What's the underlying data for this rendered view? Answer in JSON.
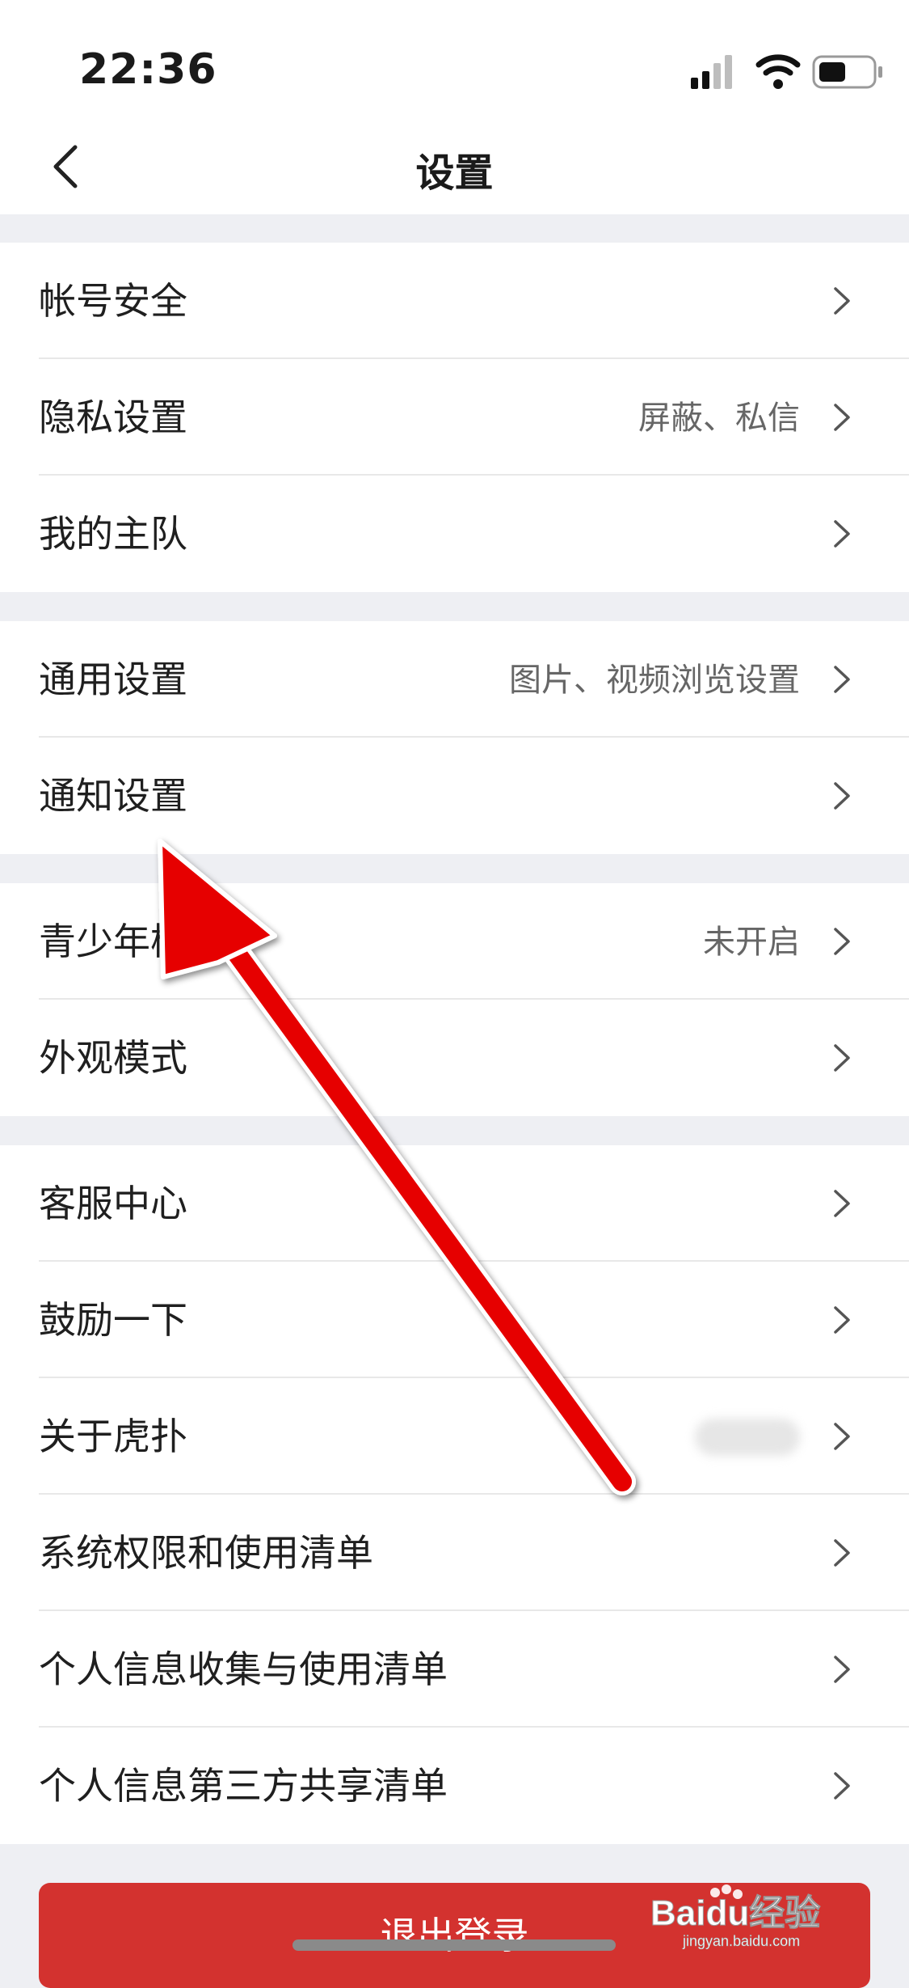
{
  "status_bar": {
    "time": "22:36"
  },
  "header": {
    "title": "设置"
  },
  "groups": [
    {
      "items": [
        {
          "label": "帐号安全",
          "value": ""
        },
        {
          "label": "隐私设置",
          "value": "屏蔽、私信"
        },
        {
          "label": "我的主队",
          "value": ""
        }
      ]
    },
    {
      "items": [
        {
          "label": "通用设置",
          "value": "图片、视频浏览设置"
        },
        {
          "label": "通知设置",
          "value": ""
        }
      ]
    },
    {
      "items": [
        {
          "label": "青少年模",
          "value": "未开启"
        },
        {
          "label": "外观模式",
          "value": ""
        }
      ]
    },
    {
      "items": [
        {
          "label": "客服中心",
          "value": ""
        },
        {
          "label": "鼓励一下",
          "value": ""
        },
        {
          "label": "关于虎扑",
          "value": ""
        },
        {
          "label": "系统权限和使用清单",
          "value": ""
        },
        {
          "label": "个人信息收集与使用清单",
          "value": ""
        },
        {
          "label": "个人信息第三方共享清单",
          "value": ""
        }
      ]
    }
  ],
  "logout": {
    "label": "退出登录"
  },
  "watermark": {
    "text": "Baidu经验",
    "subtext": "jingyan.baidu.com"
  },
  "colors": {
    "accent": "#d3322f",
    "arrow": "#e60000",
    "separator": "#eeeff3"
  }
}
